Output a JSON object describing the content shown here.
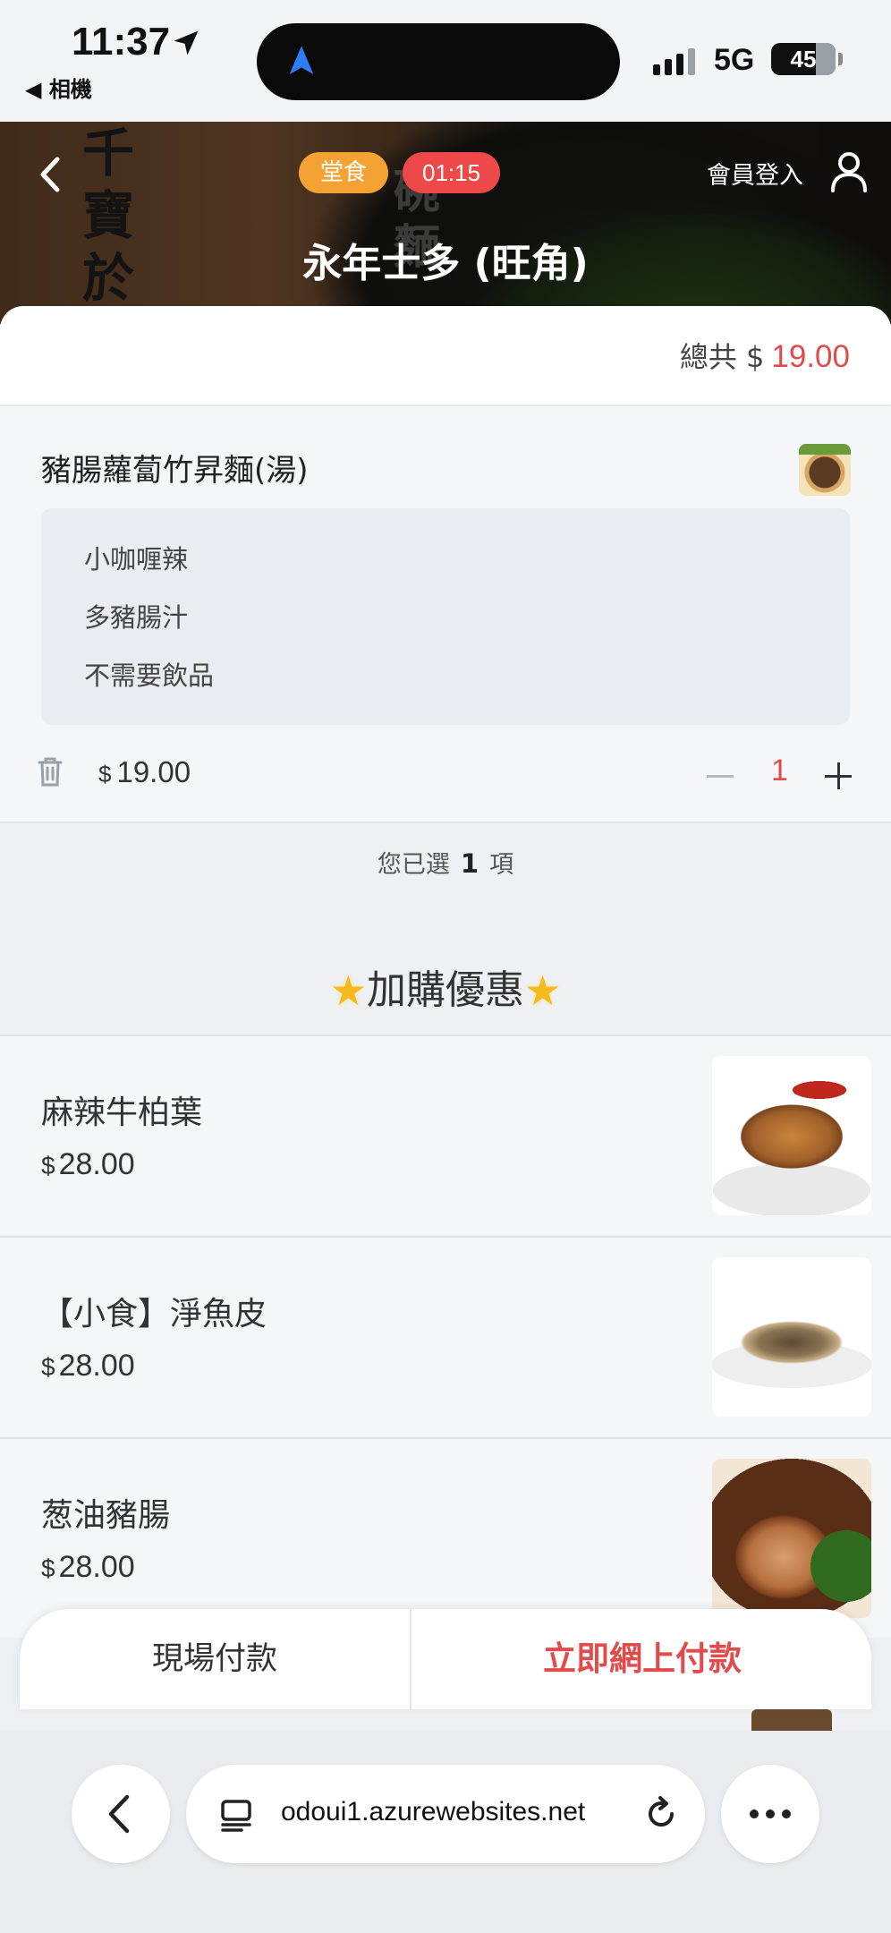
{
  "status_bar": {
    "time": "11:37",
    "back_app": "◀ 相機",
    "network": "5G",
    "battery": "45"
  },
  "header": {
    "deco_text": "千寶於",
    "deco_text2": "碗麵",
    "badge_dine": "堂食",
    "badge_timer": "01:15",
    "member_login": "會員登入",
    "store_name": "永年士多 (旺角)"
  },
  "total": {
    "label": "總共 $",
    "amount": "19.00"
  },
  "cart_item": {
    "name": "豬腸蘿蔔竹昇麵(湯)",
    "options": [
      "小咖喱辣",
      "多豬腸汁",
      "不需要飲品"
    ],
    "currency": "$",
    "price": "19.00",
    "quantity": "1"
  },
  "selected": {
    "prefix": "您已選",
    "count": "1",
    "suffix": "項"
  },
  "addon_section": {
    "title": "加購優惠",
    "items": [
      {
        "name": "麻辣牛柏葉",
        "currency": "$",
        "price": "28.00"
      },
      {
        "name": "【小食】淨魚皮",
        "currency": "$",
        "price": "28.00"
      },
      {
        "name": "葱油豬腸",
        "currency": "$",
        "price": "28.00"
      }
    ]
  },
  "payment": {
    "cash_label": "現場付款",
    "online_label": "立即網上付款"
  },
  "browser": {
    "url": "odoui1.azurewebsites.net"
  },
  "colors": {
    "accent_red": "#e14b4b",
    "dine_badge": "#f4a234",
    "timer_badge": "#ee4949"
  }
}
